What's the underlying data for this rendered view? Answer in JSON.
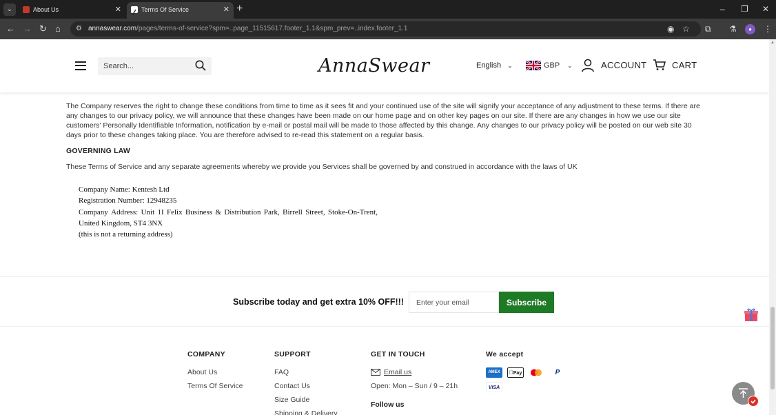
{
  "browser": {
    "tabs": [
      {
        "title": "About Us",
        "active": false
      },
      {
        "title": "Terms Of Service",
        "active": true
      }
    ],
    "url_host": "annaswear.com",
    "url_path": "/pages/terms-of-service?spm=..page_11515617.footer_1.1&spm_prev=..index.footer_1.1"
  },
  "header": {
    "search_placeholder": "Search...",
    "logo_text": "AnnaSwear",
    "language": "English",
    "currency": "GBP",
    "account_label": "ACCOUNT",
    "cart_label": "CART"
  },
  "content": {
    "paragraph1": "The Company reserves the right to change these conditions from time to time as it sees fit and your continued use of the site will signify your acceptance of any adjustment to these terms. If there are any changes to our privacy policy, we will announce that these changes have been made on our home page and on other key pages on our site. If there are any changes in how we use our site customers' Personally Identifiable Information, notification by e-mail or postal mail will be made to those affected by this change. Any changes to our privacy policy will be posted on our web site 30 days prior to these changes taking place. You are therefore advised to re-read this statement on a regular basis.",
    "governing_heading": "GOVERNING LAW",
    "paragraph2": "These Terms of Service and any separate agreements whereby we provide you Services shall be governed by and construed in accordance with the laws of UK",
    "company": {
      "name": "Company Name: Kentesh Ltd",
      "registration": "Registration Number: 12948235",
      "address_words": [
        "Company",
        "Address:",
        "Unit",
        "1I",
        "Felix",
        "Business",
        "&",
        "Distribution",
        "Park,",
        "Birrell",
        "Street,",
        "Stoke-On-Trent,"
      ],
      "address_line2": "United Kingdom, ST4 3NX",
      "note": "(this is not a returning address)"
    }
  },
  "newsletter": {
    "text": "Subscribe today and get extra 10% OFF!!!",
    "email_placeholder": "Enter your email",
    "button_label": "Subscribe"
  },
  "footer": {
    "company": {
      "heading": "COMPANY",
      "links": [
        "About Us",
        "Terms Of Service"
      ]
    },
    "support": {
      "heading": "SUPPORT",
      "links": [
        "FAQ",
        "Contact Us",
        "Size Guide",
        "Shipping & Delivery"
      ]
    },
    "contact": {
      "heading": "GET IN TOUCH",
      "email_label": "Email us",
      "hours": "Open: Mon – Sun / 9 – 21h",
      "follow_heading": "Follow us"
    },
    "payments": {
      "heading": "We accept",
      "methods": [
        "AMEX",
        "Pay",
        "",
        "P",
        "VISA"
      ]
    }
  },
  "colors": {
    "subscribe_button": "#1f7a25",
    "chrome_dark": "#1f1f1f",
    "chrome_toolbar": "#3c3c3c"
  }
}
